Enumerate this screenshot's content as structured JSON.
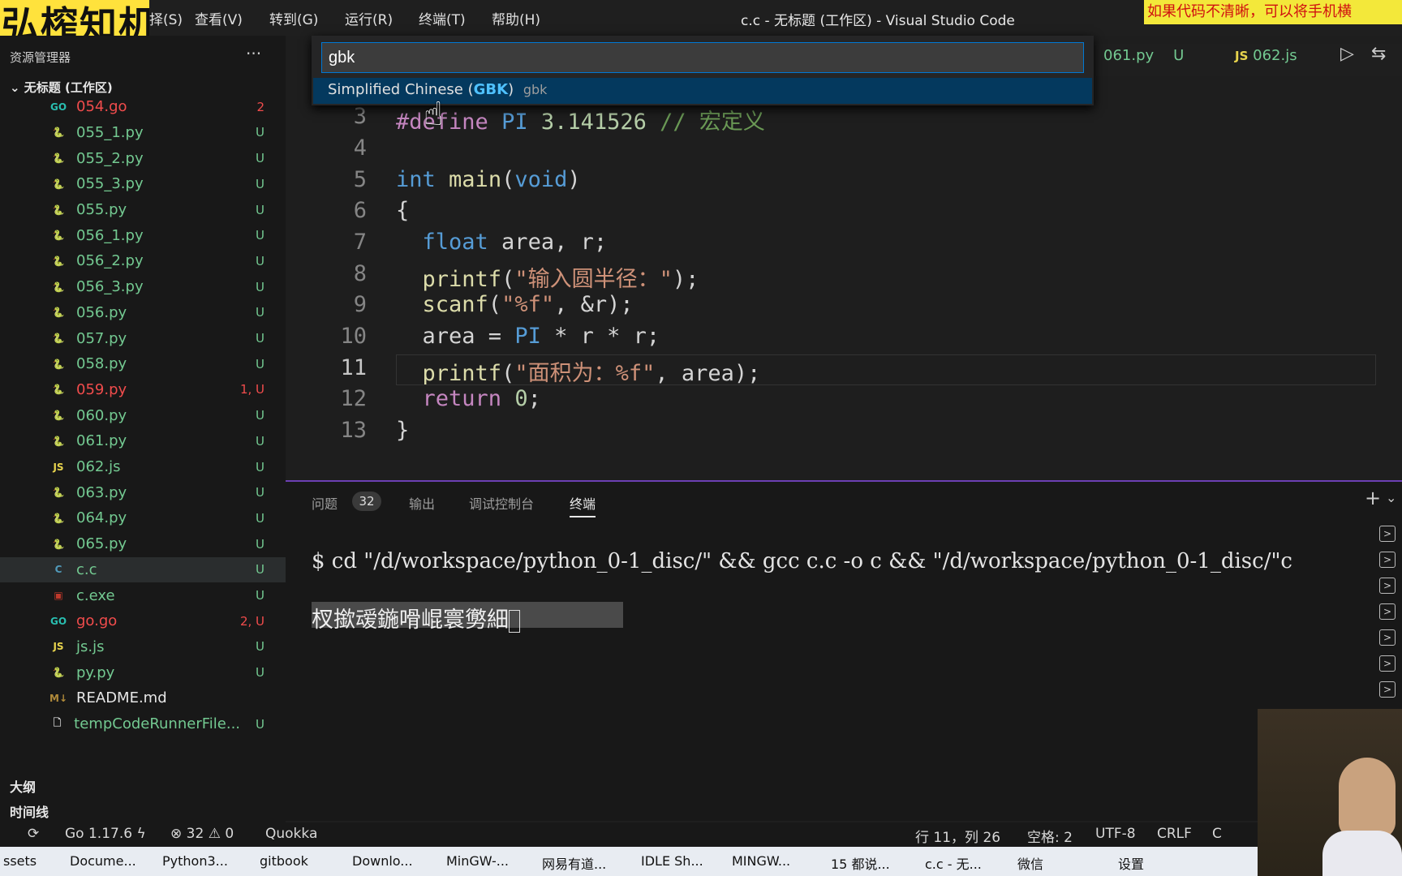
{
  "logo_text": "弘榨知机",
  "menu": [
    "择(S)",
    "查看(V)",
    "转到(G)",
    "运行(R)",
    "终端(T)",
    "帮助(H)"
  ],
  "window_title": "c.c - 无标题 (工作区) - Visual Studio Code",
  "banner_text": "如果代码不清晰，可以将手机横",
  "sidebar": {
    "title": "资源管理器",
    "more": "···",
    "workspace": "无标题 (工作区)",
    "files": [
      {
        "icon": "go-icon",
        "name": "054.go",
        "status": "2",
        "color": "#f14c4c"
      },
      {
        "icon": "python-icon",
        "name": "055_1.py",
        "status": "U",
        "color": "#73c991"
      },
      {
        "icon": "python-icon",
        "name": "055_2.py",
        "status": "U",
        "color": "#73c991"
      },
      {
        "icon": "python-icon",
        "name": "055_3.py",
        "status": "U",
        "color": "#73c991"
      },
      {
        "icon": "python-icon",
        "name": "055.py",
        "status": "U",
        "color": "#73c991"
      },
      {
        "icon": "python-icon",
        "name": "056_1.py",
        "status": "U",
        "color": "#73c991"
      },
      {
        "icon": "python-icon",
        "name": "056_2.py",
        "status": "U",
        "color": "#73c991"
      },
      {
        "icon": "python-icon",
        "name": "056_3.py",
        "status": "U",
        "color": "#73c991"
      },
      {
        "icon": "python-icon",
        "name": "056.py",
        "status": "U",
        "color": "#73c991"
      },
      {
        "icon": "python-icon",
        "name": "057.py",
        "status": "U",
        "color": "#73c991"
      },
      {
        "icon": "python-icon",
        "name": "058.py",
        "status": "U",
        "color": "#73c991"
      },
      {
        "icon": "python-icon",
        "name": "059.py",
        "status": "1, U",
        "color": "#f14c4c"
      },
      {
        "icon": "python-icon",
        "name": "060.py",
        "status": "U",
        "color": "#73c991"
      },
      {
        "icon": "python-icon",
        "name": "061.py",
        "status": "U",
        "color": "#73c991"
      },
      {
        "icon": "js-icon",
        "name": "062.js",
        "status": "U",
        "color": "#73c991"
      },
      {
        "icon": "python-icon",
        "name": "063.py",
        "status": "U",
        "color": "#73c991"
      },
      {
        "icon": "python-icon",
        "name": "064.py",
        "status": "U",
        "color": "#73c991"
      },
      {
        "icon": "python-icon",
        "name": "065.py",
        "status": "U",
        "color": "#73c991"
      },
      {
        "icon": "c-icon",
        "name": "c.c",
        "status": "U",
        "color": "#73c991"
      },
      {
        "icon": "exe-icon",
        "name": "c.exe",
        "status": "U",
        "color": "#73c991"
      },
      {
        "icon": "go-icon",
        "name": "go.go",
        "status": "2, U",
        "color": "#f14c4c"
      },
      {
        "icon": "js-icon",
        "name": "js.js",
        "status": "U",
        "color": "#73c991"
      },
      {
        "icon": "python-icon",
        "name": "py.py",
        "status": "U",
        "color": "#73c991"
      },
      {
        "icon": "markdown-icon",
        "name": "README.md",
        "status": "",
        "color": "#e6e6e6"
      },
      {
        "icon": "file-icon",
        "name": "tempCodeRunnerFile...",
        "status": "U",
        "color": "#73c991"
      }
    ],
    "outline": "大纲",
    "timeline": "时间线"
  },
  "tabs": {
    "tab1": "061.py",
    "tab1_status": "U",
    "tab2_prefix": "JS",
    "tab2": "062.js"
  },
  "palette": {
    "input_value": "gbk",
    "item_main": "Simplified Chinese (",
    "item_highlight": "GBK",
    "item_close": ")",
    "item_desc": "gbk"
  },
  "editor": {
    "line_numbers": [
      "3",
      "4",
      "5",
      "6",
      "7",
      "8",
      "9",
      "10",
      "11",
      "12",
      "13"
    ],
    "current_line": "11"
  },
  "panel": {
    "tabs": [
      "问题",
      "输出",
      "调试控制台",
      "终端"
    ],
    "problems_count": "32",
    "active_tab": "终端",
    "terminal_line1": "$ cd \"/d/workspace/python_0-1_disc/\" && gcc c.c -o c && \"/d/workspace/python_0-1_disc/\"c",
    "terminal_output": "杈撳叆鍦嗗崐寰勶細"
  },
  "status": {
    "go_version": "Go 1.17.6",
    "errors": "32",
    "warnings": "0",
    "quokka": "Quokka",
    "position": "行 11，列 26",
    "spaces": "空格: 2",
    "encoding": "UTF-8",
    "eol": "CRLF",
    "language": "C"
  },
  "taskbar": [
    "ssets",
    "Docume...",
    "Python3...",
    "gitbook",
    "Downlo...",
    "MinGW-...",
    "网易有道...",
    "IDLE Sh...",
    "MINGW...",
    "15 都说...",
    "c.c - 无...",
    "微信",
    "设置"
  ]
}
